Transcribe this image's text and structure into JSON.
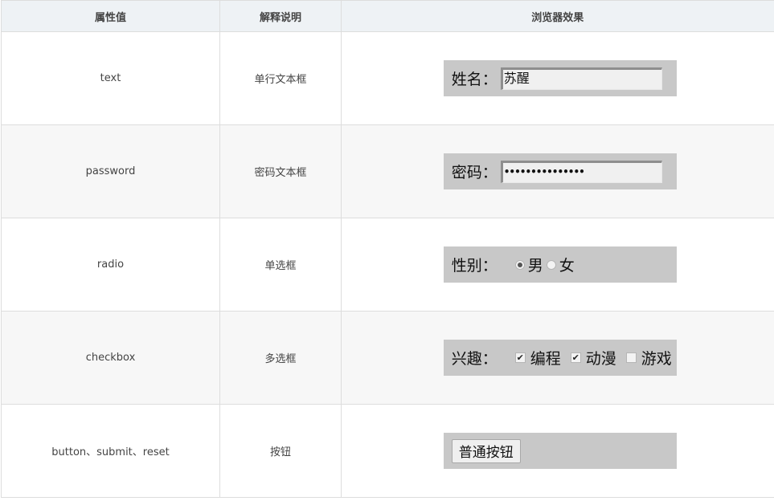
{
  "header": {
    "col1": "属性值",
    "col2": "解释说明",
    "col3": "浏览器效果"
  },
  "rows": [
    {
      "value": "text",
      "desc": "单行文本框",
      "demo": {
        "label": "姓名：",
        "input_value": "苏醒"
      }
    },
    {
      "value": "password",
      "desc": "密码文本框",
      "demo": {
        "label": "密码：",
        "input_value": "•••••••••••••••"
      }
    },
    {
      "value": "radio",
      "desc": "单选框",
      "demo": {
        "label": "性别：",
        "options": [
          {
            "label": "男",
            "checked": true
          },
          {
            "label": "女",
            "checked": false
          }
        ]
      }
    },
    {
      "value": "checkbox",
      "desc": "多选框",
      "demo": {
        "label": "兴趣：",
        "options": [
          {
            "label": "编程",
            "checked": true
          },
          {
            "label": "动漫",
            "checked": true
          },
          {
            "label": "游戏",
            "checked": false
          }
        ]
      }
    },
    {
      "value": "button、submit、reset",
      "desc": "按钮",
      "demo": {
        "button_label": "普通按钮"
      }
    }
  ],
  "colors": {
    "header_bg": "#eef2f5",
    "alt_row_bg": "#f7f7f7",
    "demo_bg": "#c8c8c8",
    "border": "#dddddd"
  }
}
